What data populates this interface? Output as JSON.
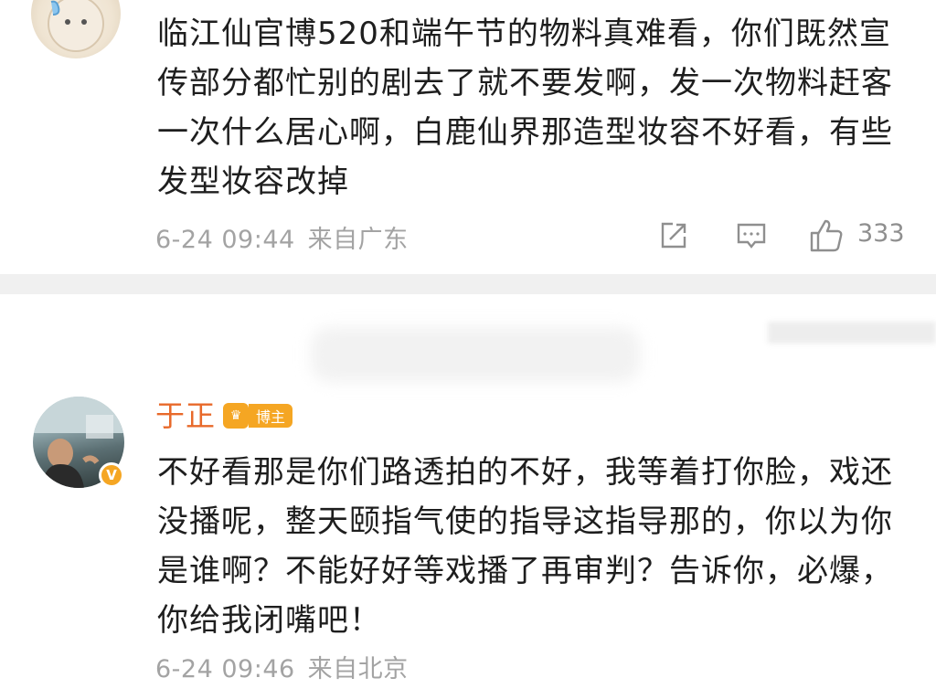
{
  "comment1": {
    "text": "临江仙官博520和端午节的物料真难看，你们既然宣传部分都忙别的剧去了就不要发啊，发一次物料赶客一次什么居心啊，白鹿仙界那造型妆容不好看，有些发型妆容改掉",
    "time": "6-24 09:44",
    "location": "来自广东",
    "like_count": "333",
    "icons": [
      "share-icon",
      "reply-icon",
      "like-icon"
    ]
  },
  "comment2": {
    "author": "于正",
    "badge_label": "博主",
    "verified_mark": "V",
    "text": "不好看那是你们路透拍的不好，我等着打你脸，戏还没播呢，整天颐指气使的指导这指导那的，你以为你是谁啊？不能好好等戏播了再审判？告诉你，必爆，你给我闭嘴吧！",
    "time": "6-24 09:46",
    "location": "来自北京"
  },
  "colors": {
    "author_name": "#e8692a",
    "badge": "#f5a623",
    "meta_text": "#a3a3a3",
    "divider": "#f0f0f0"
  }
}
